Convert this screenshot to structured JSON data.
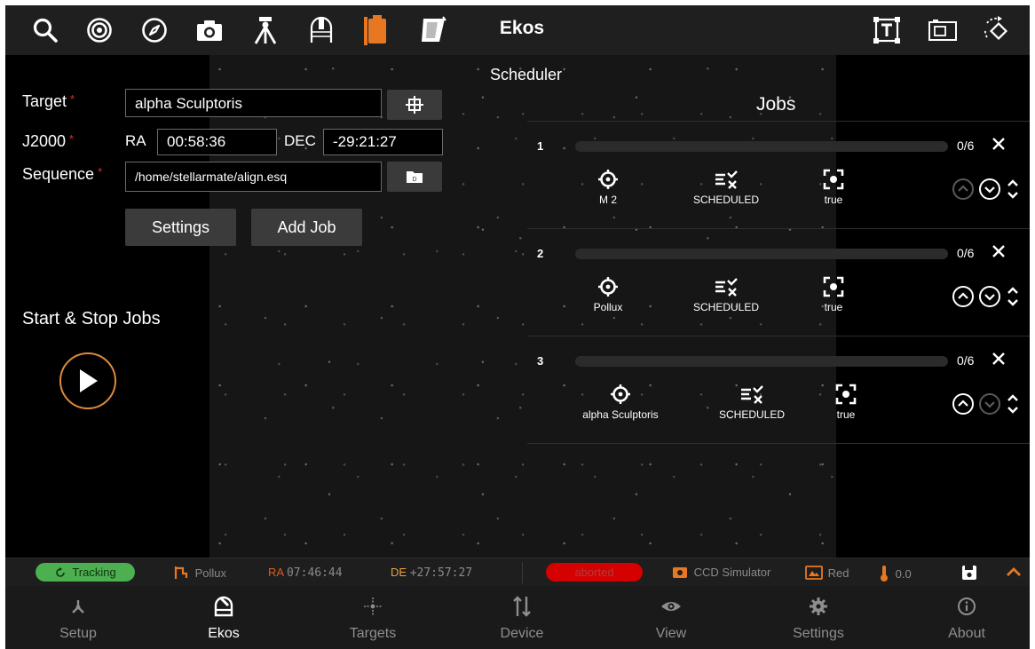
{
  "app": {
    "title": "Ekos",
    "toolbar_icons": [
      "search-icon",
      "target-icon",
      "compass-icon",
      "camera-icon",
      "tripod-icon",
      "observatory-icon",
      "dust-cap-icon",
      "flat-panel-icon",
      "text-box-icon",
      "capture-frame-icon",
      "dither-icon"
    ]
  },
  "left_panel": {
    "target_label": "Target",
    "target_value": "alpha Sculptoris",
    "j2000_label": "J2000",
    "ra_label": "RA",
    "ra_value": "00:58:36",
    "dec_label": "DEC",
    "dec_value": "-29:21:27",
    "sequence_label": "Sequence",
    "sequence_value": "/home/stellarmate/align.esq",
    "required_mark": "*",
    "settings_label": "Settings",
    "add_job_label": "Add Job",
    "start_stop_title": "Start & Stop Jobs"
  },
  "scheduler": {
    "title": "Scheduler",
    "jobs_title": "Jobs",
    "jobs": [
      {
        "number": "1",
        "progress": "0/6",
        "progress_fraction": 0,
        "target": "M 2",
        "status": "SCHEDULED",
        "flag": "true"
      },
      {
        "number": "2",
        "progress": "0/6",
        "progress_fraction": 0,
        "target": "Pollux",
        "status": "SCHEDULED",
        "flag": "true"
      },
      {
        "number": "3",
        "progress": "0/6",
        "progress_fraction": 0,
        "target": "alpha Sculptoris",
        "status": "SCHEDULED",
        "flag": "true"
      }
    ]
  },
  "status_bar": {
    "tracking": "Tracking",
    "mount_target": "Pollux",
    "ra_label": "RA",
    "ra_value": "07:46:44",
    "de_label": "DE",
    "de_value": "+27:57:27",
    "state": "aborted",
    "camera": "CCD Simulator",
    "filter": "Red",
    "temperature": "0.0"
  },
  "bottom_nav": {
    "items": [
      {
        "label": "Setup",
        "icon": "setup-icon"
      },
      {
        "label": "Ekos",
        "icon": "ekos-icon"
      },
      {
        "label": "Targets",
        "icon": "targets-icon"
      },
      {
        "label": "Device",
        "icon": "device-icon"
      },
      {
        "label": "View",
        "icon": "view-icon"
      },
      {
        "label": "Settings",
        "icon": "settings-icon"
      },
      {
        "label": "About",
        "icon": "about-icon"
      }
    ]
  },
  "colors": {
    "accent": "#e87722",
    "required": "#e03030",
    "tracking_bg": "#4caf50",
    "aborted_bg": "#d50000",
    "ra_label": "#e05a1e",
    "de_label": "#e8a23a"
  }
}
